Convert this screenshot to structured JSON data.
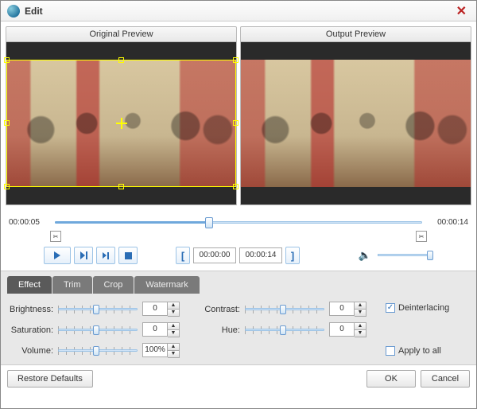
{
  "window": {
    "title": "Edit"
  },
  "previews": {
    "original": "Original Preview",
    "output": "Output Preview"
  },
  "timeline": {
    "start": "00:00:05",
    "end": "00:00:14",
    "trim_start": "00:00:00",
    "trim_end": "00:00:14"
  },
  "tabs": {
    "effect": "Effect",
    "trim": "Trim",
    "crop": "Crop",
    "watermark": "Watermark"
  },
  "params": {
    "brightness": {
      "label": "Brightness:",
      "value": "0"
    },
    "saturation": {
      "label": "Saturation:",
      "value": "0"
    },
    "volume": {
      "label": "Volume:",
      "value": "100%"
    },
    "contrast": {
      "label": "Contrast:",
      "value": "0"
    },
    "hue": {
      "label": "Hue:",
      "value": "0"
    }
  },
  "checkboxes": {
    "deinterlacing": "Deinterlacing",
    "apply_all": "Apply to all"
  },
  "footer": {
    "restore": "Restore Defaults",
    "ok": "OK",
    "cancel": "Cancel"
  }
}
